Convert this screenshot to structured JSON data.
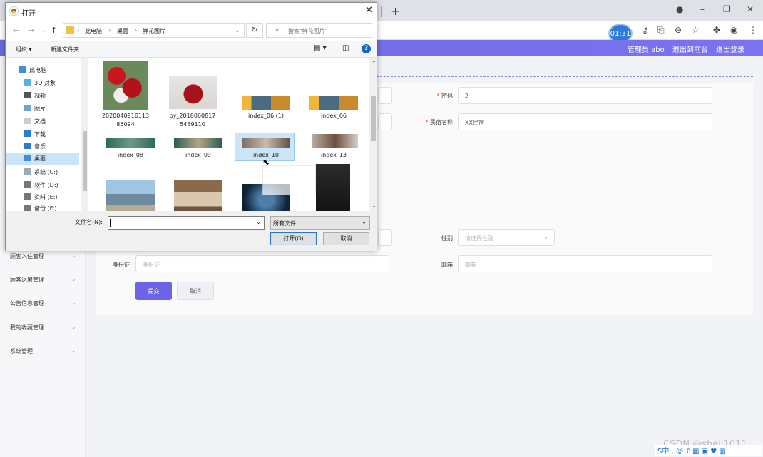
{
  "browser": {
    "timer": "01:31"
  },
  "app_header": {
    "admin": "管理员 abo",
    "back_front": "退出到前台",
    "logout": "退出登录"
  },
  "sidebar": {
    "items": [
      "顾客入住管理",
      "顾客退房管理",
      "公告信息管理",
      "我的收藏管理",
      "系统管理"
    ]
  },
  "form": {
    "password_label": "密码",
    "password_value": "2",
    "homestay_label": "民宿名称",
    "homestay_value": "XX民宿",
    "gender_label": "性别",
    "gender_placeholder": "请选择性别",
    "idcard_label": "身份证",
    "idcard_placeholder": "身份证",
    "email_label": "邮箱",
    "email_placeholder": "邮箱",
    "submit": "提交",
    "cancel": "取消"
  },
  "dialog": {
    "title": "打开",
    "breadcrumb": [
      "此电脑",
      "桌面",
      "鲜花图片"
    ],
    "search_placeholder": "搜索\"鲜花图片\"",
    "organize": "组织 ▾",
    "new_folder": "新建文件夹",
    "nav_items": [
      "此电脑",
      "3D 对象",
      "视频",
      "图片",
      "文档",
      "下载",
      "音乐",
      "桌面",
      "系统 (C:)",
      "软件 (D:)",
      "资料 (E:)",
      "备份 (F:)"
    ],
    "files": [
      {
        "name": "2020040916113\n85094"
      },
      {
        "name": "by_2018060817\n5459110"
      },
      {
        "name": "index_06 (1)"
      },
      {
        "name": "index_06"
      },
      {
        "name": "index_08"
      },
      {
        "name": "index_09"
      },
      {
        "name": "index_10"
      },
      {
        "name": "index_13"
      }
    ],
    "filename_label": "文件名(N):",
    "filetype": "所有文件",
    "open": "打开(O)",
    "cancel": "取消"
  },
  "watermark": "CSDN @sheji1011",
  "ime": "S中·, ☺ ♪ ▦ ▣ ♥ ▦"
}
